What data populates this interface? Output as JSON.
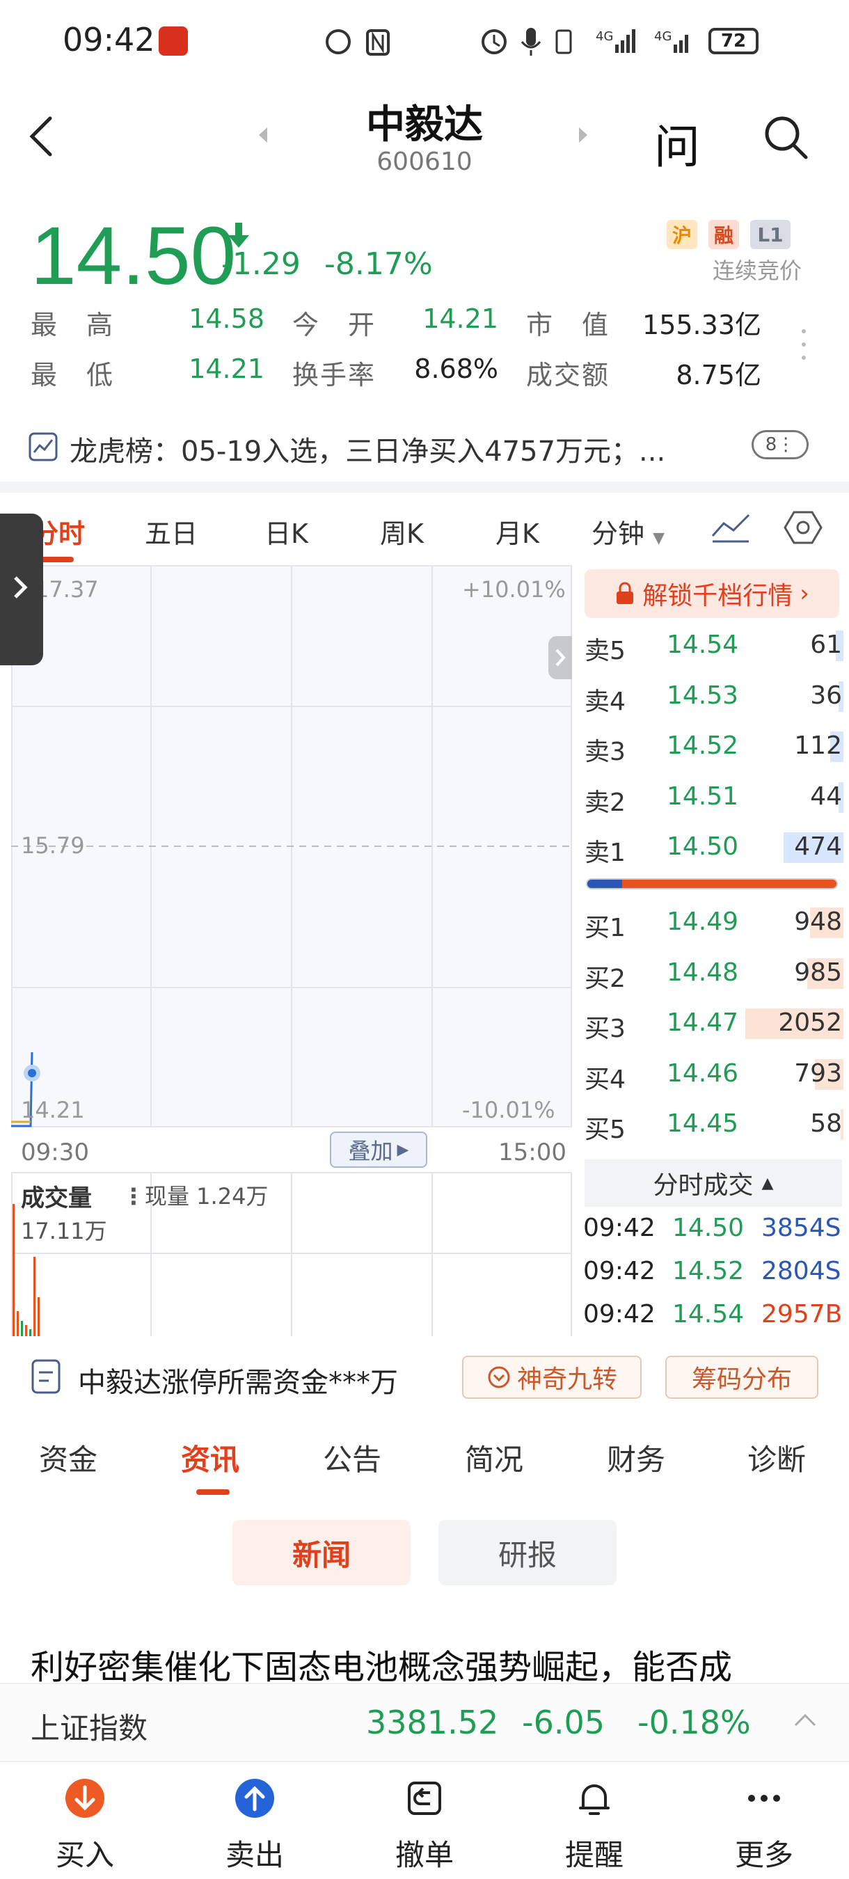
{
  "status_bar": {
    "time": "09:42",
    "battery": "72"
  },
  "header": {
    "stock_name": "中毅达",
    "stock_code": "600610",
    "ask_label": "问"
  },
  "quote": {
    "price": "14.50",
    "change": "-1.29",
    "change_pct": "-8.17%",
    "tags": [
      "沪",
      "融",
      "L1"
    ],
    "auction_status": "连续竞价",
    "stats": [
      {
        "label": "最　高",
        "value": "14.58"
      },
      {
        "label": "今　开",
        "value": "14.21"
      },
      {
        "label": "市　值",
        "value": "155.33亿"
      },
      {
        "label": "最　低",
        "value": "14.21"
      },
      {
        "label": "换手率",
        "value": "8.68%"
      },
      {
        "label": "成交额",
        "value": "8.75亿"
      }
    ]
  },
  "dragon_tiger": {
    "text": "龙虎榜：05-19入选，三日净买入4757万元；...",
    "badge": "8"
  },
  "chart_tabs": [
    "分时",
    "五日",
    "日K",
    "周K",
    "月K",
    "分钟"
  ],
  "chart": {
    "y_top": "17.37",
    "y_mid": "15.79",
    "y_bottom": "14.21",
    "pct_top": "+10.01%",
    "pct_bottom": "-10.01%",
    "time_start": "09:30",
    "time_end": "15:00",
    "overlay_label": "叠加"
  },
  "volume": {
    "title": "成交量",
    "now": "现量 1.24万",
    "total": "17.11万"
  },
  "order_book": {
    "unlock_label": "解锁千档行情",
    "asks": [
      {
        "label": "卖5",
        "price": "14.54",
        "volume": "61",
        "bar": 0.03
      },
      {
        "label": "卖4",
        "price": "14.53",
        "volume": "36",
        "bar": 0.02
      },
      {
        "label": "卖3",
        "price": "14.52",
        "volume": "112",
        "bar": 0.05
      },
      {
        "label": "卖2",
        "price": "14.51",
        "volume": "44",
        "bar": 0.02
      },
      {
        "label": "卖1",
        "price": "14.50",
        "volume": "474",
        "bar": 0.23
      }
    ],
    "bids": [
      {
        "label": "买1",
        "price": "14.49",
        "volume": "948",
        "bar": 0.13
      },
      {
        "label": "买2",
        "price": "14.48",
        "volume": "985",
        "bar": 0.14
      },
      {
        "label": "买3",
        "price": "14.47",
        "volume": "2052",
        "bar": 0.38
      },
      {
        "label": "买4",
        "price": "14.46",
        "volume": "793",
        "bar": 0.11
      },
      {
        "label": "买5",
        "price": "14.45",
        "volume": "58",
        "bar": 0.01
      }
    ],
    "buy_ratio": 0.14
  },
  "ticks": {
    "header": "分时成交",
    "rows": [
      {
        "time": "09:42",
        "price": "14.50",
        "volume": "3854S",
        "side": "sell"
      },
      {
        "time": "09:42",
        "price": "14.52",
        "volume": "2804S",
        "side": "sell"
      },
      {
        "time": "09:42",
        "price": "14.54",
        "volume": "2957B",
        "side": "buy"
      }
    ]
  },
  "banner": {
    "limit_text": "中毅达涨停所需资金***万",
    "nine_turn": "神奇九转",
    "chip": "筹码分布"
  },
  "info_tabs": [
    "资金",
    "资讯",
    "公告",
    "简况",
    "财务",
    "诊断"
  ],
  "news_pills": {
    "news": "新闻",
    "report": "研报"
  },
  "headline": "利好密集催化下固态电池概念强势崛起，能否成",
  "index_bar": {
    "name": "上证指数",
    "value": "3381.52",
    "change": "-6.05",
    "pct": "-0.18%"
  },
  "bottom_nav": [
    "买入",
    "卖出",
    "撤单",
    "提醒",
    "更多"
  ],
  "colors": {
    "down": "#1f9d55",
    "up": "#e0401c",
    "accent": "#e0401c",
    "sell_blue": "#2a56b8"
  }
}
